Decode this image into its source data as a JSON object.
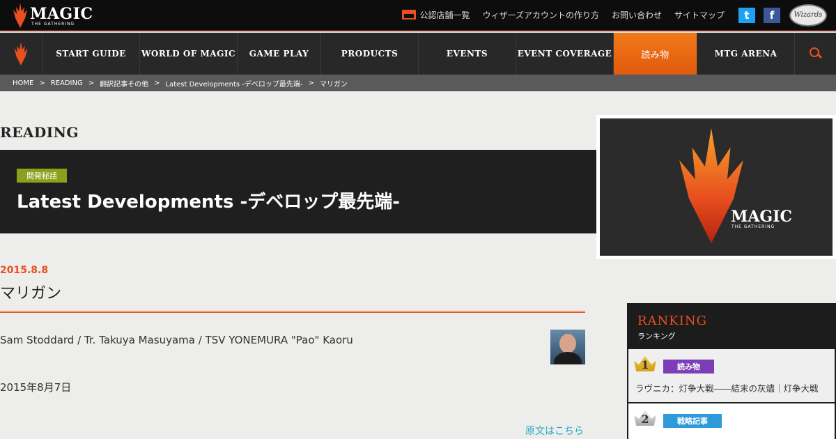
{
  "header": {
    "logo_text": "MAGIC",
    "logo_sub": "THE GATHERING",
    "links": [
      "公認店舗一覧",
      "ウィザーズアカウントの作り方",
      "お問い合わせ",
      "サイトマップ"
    ],
    "twitter_glyph": "t",
    "facebook_glyph": "f",
    "wizards_text": "Wizards"
  },
  "nav": {
    "items": [
      {
        "label": "START GUIDE"
      },
      {
        "label": "WORLD OF MAGIC"
      },
      {
        "label": "GAME PLAY"
      },
      {
        "label": "PRODUCTS"
      },
      {
        "label": "EVENTS"
      },
      {
        "label": "EVENT COVERAGE"
      },
      {
        "label": "読み物"
      },
      {
        "label": "MTG ARENA"
      }
    ],
    "active_color": "#e8501f"
  },
  "breadcrumb": [
    "HOME",
    "READING",
    "翻訳記事その他",
    "Latest Developments -デベロップ最先端-",
    "マリガン"
  ],
  "breadcrumb_sep": ">",
  "section": {
    "title": "READING"
  },
  "hero": {
    "badge": "開発秘話",
    "title": "Latest Developments -デベロップ最先端-"
  },
  "promo": {
    "logo_text": "MAGIC",
    "logo_sub": "THE GATHERING"
  },
  "article": {
    "date": "2015.8.8",
    "title": "マリガン",
    "authors": "Sam Stoddard / Tr. Takuya Masuyama / TSV YONEMURA \"Pao\" Kaoru",
    "pubdate": "2015年8月7日",
    "original_link": "原文はこちら"
  },
  "ranking": {
    "title": "RANKING",
    "subtitle": "ランキング",
    "items": [
      {
        "rank": "1",
        "category": "読み物",
        "text": "ラヴニカ：灯争大戦――結末の灰燼｜灯争大戦"
      },
      {
        "rank": "2",
        "category": "戦略記事",
        "text": ""
      }
    ]
  }
}
